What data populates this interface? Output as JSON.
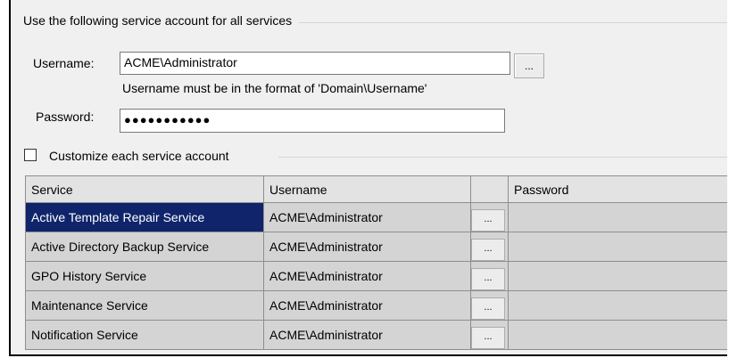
{
  "group": {
    "title": "Use the following service account for all services"
  },
  "username": {
    "label": "Username:",
    "value": "ACME\\Administrator",
    "browse_label": "...",
    "hint": "Username must be in the format of 'Domain\\Username'"
  },
  "password": {
    "label": "Password:",
    "value": "●●●●●●●●●●●"
  },
  "customize": {
    "label": "Customize each service account",
    "checked": false
  },
  "grid": {
    "columns": [
      "Service",
      "Username",
      "",
      "Password"
    ],
    "rows": [
      {
        "service": "Active Template Repair Service",
        "username": "ACME\\Administrator",
        "button": "...",
        "password": ""
      },
      {
        "service": "Active Directory Backup Service",
        "username": "ACME\\Administrator",
        "button": "...",
        "password": ""
      },
      {
        "service": "GPO History Service",
        "username": "ACME\\Administrator",
        "button": "...",
        "password": ""
      },
      {
        "service": "Maintenance Service",
        "username": "ACME\\Administrator",
        "button": "...",
        "password": ""
      },
      {
        "service": "Notification Service",
        "username": "ACME\\Administrator",
        "button": "...",
        "password": ""
      }
    ]
  },
  "colors": {
    "selection": "#0f246a",
    "background": "#f0f0f0",
    "grid_fill": "#d4d4d4"
  }
}
